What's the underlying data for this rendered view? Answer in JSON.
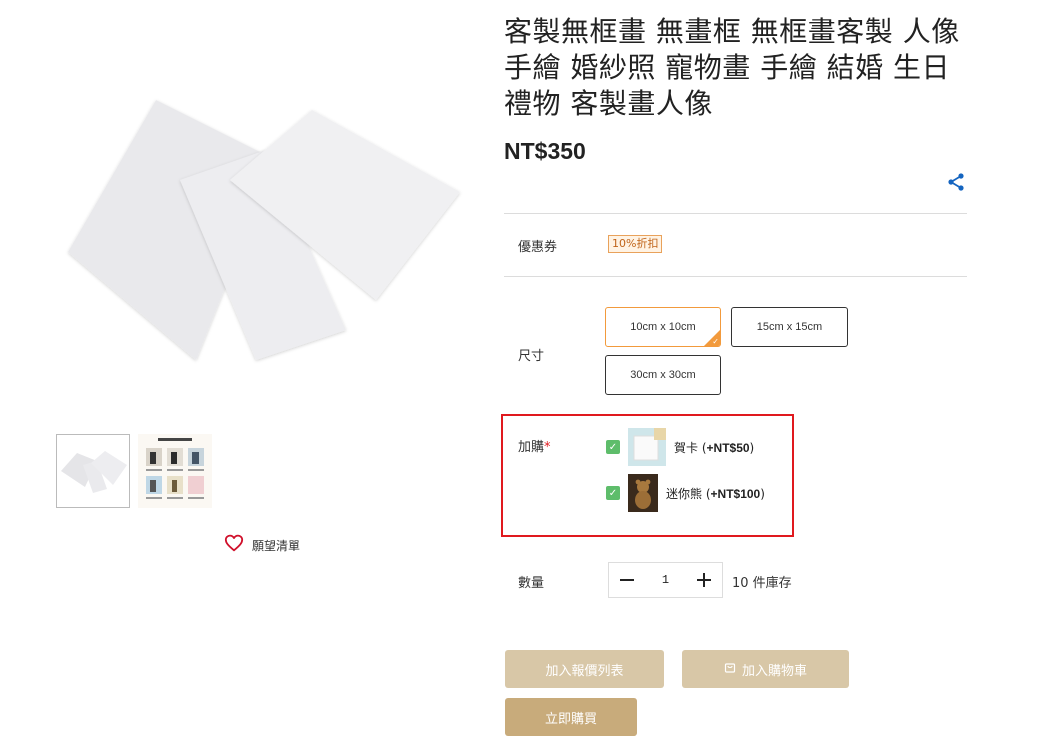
{
  "product": {
    "title": "客製無框畫 無畫框 無框畫客製 人像手繪 婚紗照 寵物畫 手繪 結婚 生日禮物 客製畫人像",
    "price": "NT$350"
  },
  "wishlist": {
    "label": "願望清單",
    "icon": "heart-outline-icon"
  },
  "coupon": {
    "label": "優惠券",
    "badge": "10%折扣"
  },
  "size": {
    "label": "尺寸",
    "options": [
      "10cm x 10cm",
      "15cm x 15cm",
      "30cm x 30cm"
    ],
    "selected": "10cm x 10cm"
  },
  "addon": {
    "label": "加購",
    "required_mark": "*",
    "items": [
      {
        "name": "賀卡",
        "price": "+NT$50",
        "checked": true
      },
      {
        "name": "迷你熊",
        "price": "+NT$100",
        "checked": true
      }
    ]
  },
  "quantity": {
    "label": "數量",
    "value": "1",
    "stock": "10 件庫存"
  },
  "buttons": {
    "quote": "加入報價列表",
    "cart": "加入購物車",
    "buy_now": "立即購買"
  },
  "colors": {
    "accent_orange": "#f29a3c",
    "highlight_red": "#e0191e",
    "button_light": "#d8c7a7",
    "button_dark": "#c8ab7b",
    "share_blue": "#1565c0"
  }
}
